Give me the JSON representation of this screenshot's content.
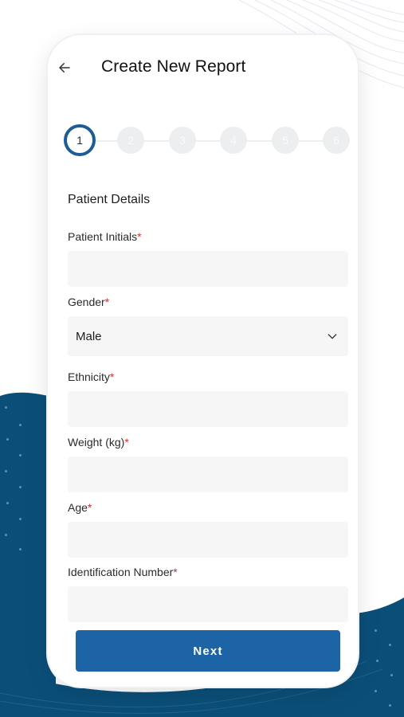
{
  "header": {
    "title": "Create New Report",
    "back_icon": "arrow-left-icon"
  },
  "stepper": {
    "steps": [
      "1",
      "2",
      "3",
      "4",
      "5",
      "6"
    ],
    "active_step": 1
  },
  "form": {
    "section_title": "Patient Details",
    "required_mark": "*",
    "fields": {
      "patient_initials": {
        "label": "Patient Initials",
        "value": ""
      },
      "gender": {
        "label": "Gender",
        "value": "Male"
      },
      "ethnicity": {
        "label": "Ethnicity",
        "value": ""
      },
      "weight": {
        "label": "Weight (kg)",
        "value": ""
      },
      "age": {
        "label": "Age",
        "value": ""
      },
      "identification_number": {
        "label": "Identification Number",
        "value": ""
      }
    }
  },
  "actions": {
    "next_label": "Next"
  },
  "colors": {
    "primary": "#1c64a6",
    "active_step_ring": "#1b5d94",
    "required": "#d32f2f",
    "background_wave": "#0b4f79"
  }
}
